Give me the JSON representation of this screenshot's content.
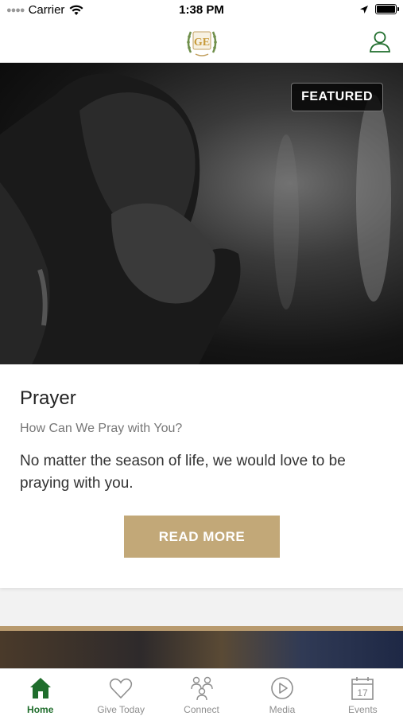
{
  "status_bar": {
    "carrier": "Carrier",
    "time": "1:38 PM",
    "icons": [
      "signal-dots-icon",
      "wifi-icon",
      "location-arrow-icon",
      "battery-icon"
    ]
  },
  "nav": {
    "logo_initials": "GE",
    "profile_icon": "user-icon"
  },
  "featured_card": {
    "badge": "FEATURED",
    "title": "Prayer",
    "subtitle": "How Can We Pray with You?",
    "body": "No matter the season of life, we would love to be praying with you.",
    "button_label": "READ MORE"
  },
  "tabs": [
    {
      "label": "Home",
      "icon": "home-icon",
      "active": true
    },
    {
      "label": "Give Today",
      "icon": "heart-icon",
      "active": false
    },
    {
      "label": "Connect",
      "icon": "people-icon",
      "active": false
    },
    {
      "label": "Media",
      "icon": "play-circle-icon",
      "active": false
    },
    {
      "label": "Events",
      "icon": "calendar-icon",
      "active": false
    }
  ],
  "calendar_day": "17",
  "colors": {
    "accent_green": "#1f6d2c",
    "button_gold": "#c2a878",
    "tab_inactive": "#8e8e8e"
  }
}
